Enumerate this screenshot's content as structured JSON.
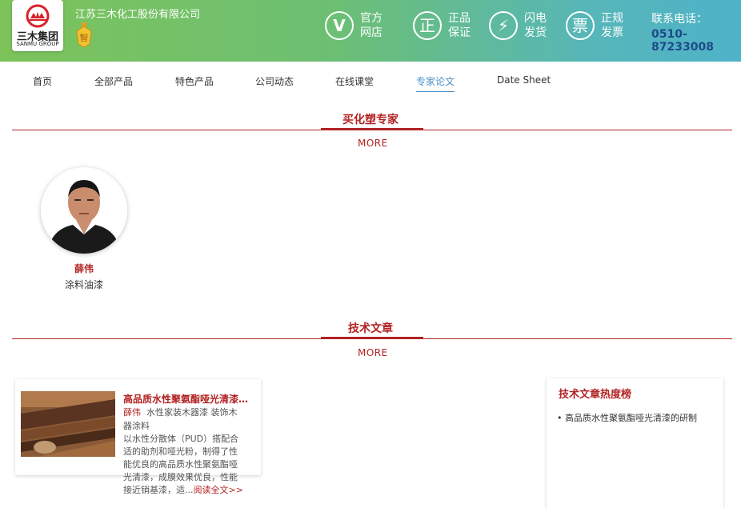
{
  "header": {
    "logo_cn": "三木集团",
    "logo_en": "SANMU GROUP",
    "medal_char": "智",
    "company_name": "江苏三木化工股份有限公司",
    "features": [
      {
        "icon": "check-v-icon",
        "glyph": "V",
        "line1": "官方",
        "line2": "网店"
      },
      {
        "icon": "genuine-icon",
        "glyph": "正",
        "line1": "正品",
        "line2": "保证"
      },
      {
        "icon": "lightning-icon",
        "glyph": "⚡",
        "line1": "闪电",
        "line2": "发货"
      },
      {
        "icon": "invoice-icon",
        "glyph": "票",
        "line1": "正规",
        "line2": "发票"
      }
    ],
    "hotline_label": "联系电话：",
    "hotline_number": "0510-87233008"
  },
  "nav": {
    "items": [
      {
        "label": "首页"
      },
      {
        "label": "全部产品"
      },
      {
        "label": "特色产品"
      },
      {
        "label": "公司动态"
      },
      {
        "label": "在线课堂"
      },
      {
        "label": "专家论文",
        "active": true
      },
      {
        "label": "Date Sheet"
      }
    ]
  },
  "experts_section": {
    "title": "买化塑专家",
    "more": "MORE",
    "expert": {
      "name": "薛伟",
      "field": "涂料油漆"
    }
  },
  "articles_section": {
    "title": "技术文章",
    "more": "MORE",
    "article": {
      "title": "高品质水性聚氨酯哑光清漆的...",
      "author": "薛伟",
      "tags_line1": "水性家装木器漆 装饰木",
      "tags_line2": "器涂料",
      "desc_lines": [
        "以水性分散体（PUD）搭配合",
        "适的助剂和哑光粉，制得了性",
        "能优良的高品质水性聚氨酯哑",
        "光清漆，成膜效果优良，性能"
      ],
      "desc_tail": "接近销基漆，适...",
      "read_more": "阅读全文>>"
    },
    "ranking": {
      "title": "技术文章热度榜",
      "items": [
        "• 高品质水性聚氨酯哑光清漆的研制"
      ]
    }
  },
  "colors": {
    "accent_red": "#b22222",
    "nav_active": "#4a90c8",
    "hotline": "#1e4a8a"
  }
}
